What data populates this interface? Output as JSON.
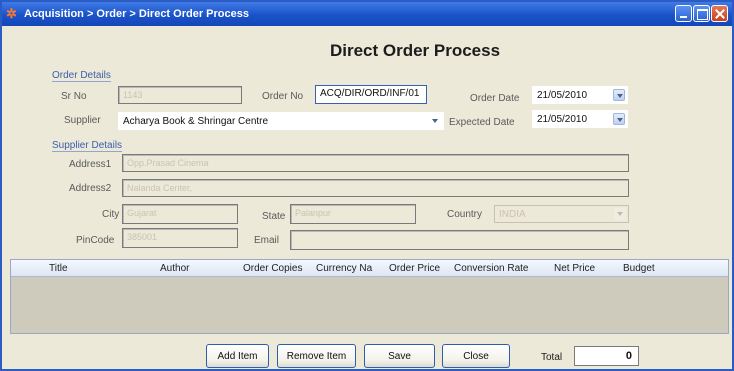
{
  "window": {
    "title": "Acquisition > Order > Direct Order Process",
    "app_icon": "gear-sparkle-icon",
    "controls": [
      "minimize-icon",
      "maximize-icon",
      "close-icon"
    ]
  },
  "page_title": "Direct Order Process",
  "order_details": {
    "legend": "Order Details",
    "sr_no_label": "Sr No",
    "sr_no_value": "1143",
    "order_no_label": "Order No",
    "order_no_value": "ACQ/DIR/ORD/INF/01",
    "order_date_label": "Order Date",
    "order_date_value": "21/05/2010",
    "supplier_label": "Supplier",
    "supplier_value": "Acharya Book & Shringar Centre",
    "expected_date_label": "Expected Date",
    "expected_date_value": "21/05/2010"
  },
  "supplier_details": {
    "legend": "Supplier Details",
    "address1_label": "Address1",
    "address1_value": "Opp.Prasad Cinema",
    "address2_label": "Address2",
    "address2_value": "Nalanda Center,",
    "city_label": "City",
    "city_value": "Gujarat",
    "state_label": "State",
    "state_value": "Palanpur",
    "country_label": "Country",
    "country_value": "INDIA",
    "pincode_label": "PinCode",
    "pincode_value": "385001",
    "email_label": "Email",
    "email_value": ""
  },
  "grid": {
    "columns": [
      "Title",
      "Author",
      "Order Copies",
      "Currency Na",
      "Order Price",
      "Conversion Rate",
      "Net Price",
      "Budget"
    ]
  },
  "actions": {
    "add_item": "Add Item",
    "remove_item": "Remove Item",
    "save": "Save",
    "close": "Close"
  },
  "total": {
    "label": "Total",
    "value": "0"
  },
  "colors": {
    "titlebar": "#1a52c9",
    "legend": "#3a5fae",
    "window_bg": "#ece9d8",
    "close_button": "#c9401b"
  }
}
